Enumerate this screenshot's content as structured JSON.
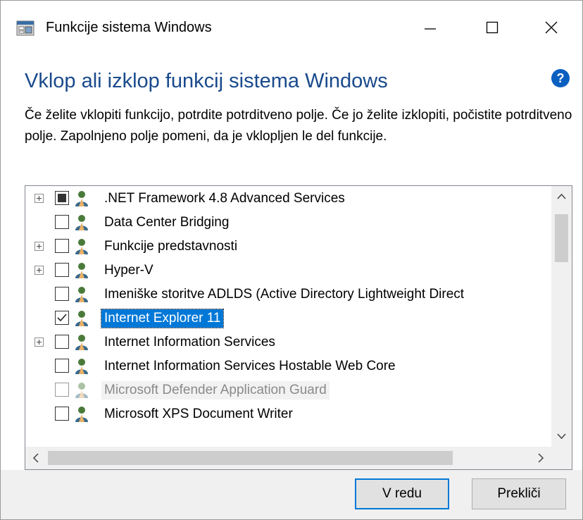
{
  "window": {
    "title": "Funkcije sistema Windows"
  },
  "heading": "Vklop ali izklop funkcij sistema Windows",
  "description": "Če želite vklopiti funkcijo, potrdite potrditveno polje. Če jo želite izklopiti, počistite potrditveno polje. Zapolnjeno polje pomeni, da je vklopljen le del funkcije.",
  "features": [
    {
      "label": ".NET Framework 4.8 Advanced Services",
      "state": "partial",
      "expandable": true
    },
    {
      "label": "Data Center Bridging",
      "state": "unchecked",
      "expandable": false
    },
    {
      "label": "Funkcije predstavnosti",
      "state": "unchecked",
      "expandable": true
    },
    {
      "label": "Hyper-V",
      "state": "unchecked",
      "expandable": true
    },
    {
      "label": "Imeniške storitve ADLDS (Active Directory Lightweight Direct",
      "state": "unchecked",
      "expandable": false
    },
    {
      "label": "Internet Explorer 11",
      "state": "checked",
      "expandable": false,
      "selected": true
    },
    {
      "label": "Internet Information Services",
      "state": "unchecked",
      "expandable": true
    },
    {
      "label": "Internet Information Services Hostable Web Core",
      "state": "unchecked",
      "expandable": false
    },
    {
      "label": "Microsoft Defender Application Guard",
      "state": "unchecked",
      "expandable": false,
      "disabled": true
    },
    {
      "label": "Microsoft XPS Document Writer",
      "state": "unchecked",
      "expandable": false
    }
  ],
  "buttons": {
    "ok": "V redu",
    "cancel": "Prekliči"
  },
  "colors": {
    "heading": "#1a4a8c",
    "selection": "#0078d7",
    "help": "#0b5fc0"
  },
  "icons": {
    "app": "windows-features-icon",
    "help": "help-icon",
    "feature": "feature-person-icon"
  }
}
